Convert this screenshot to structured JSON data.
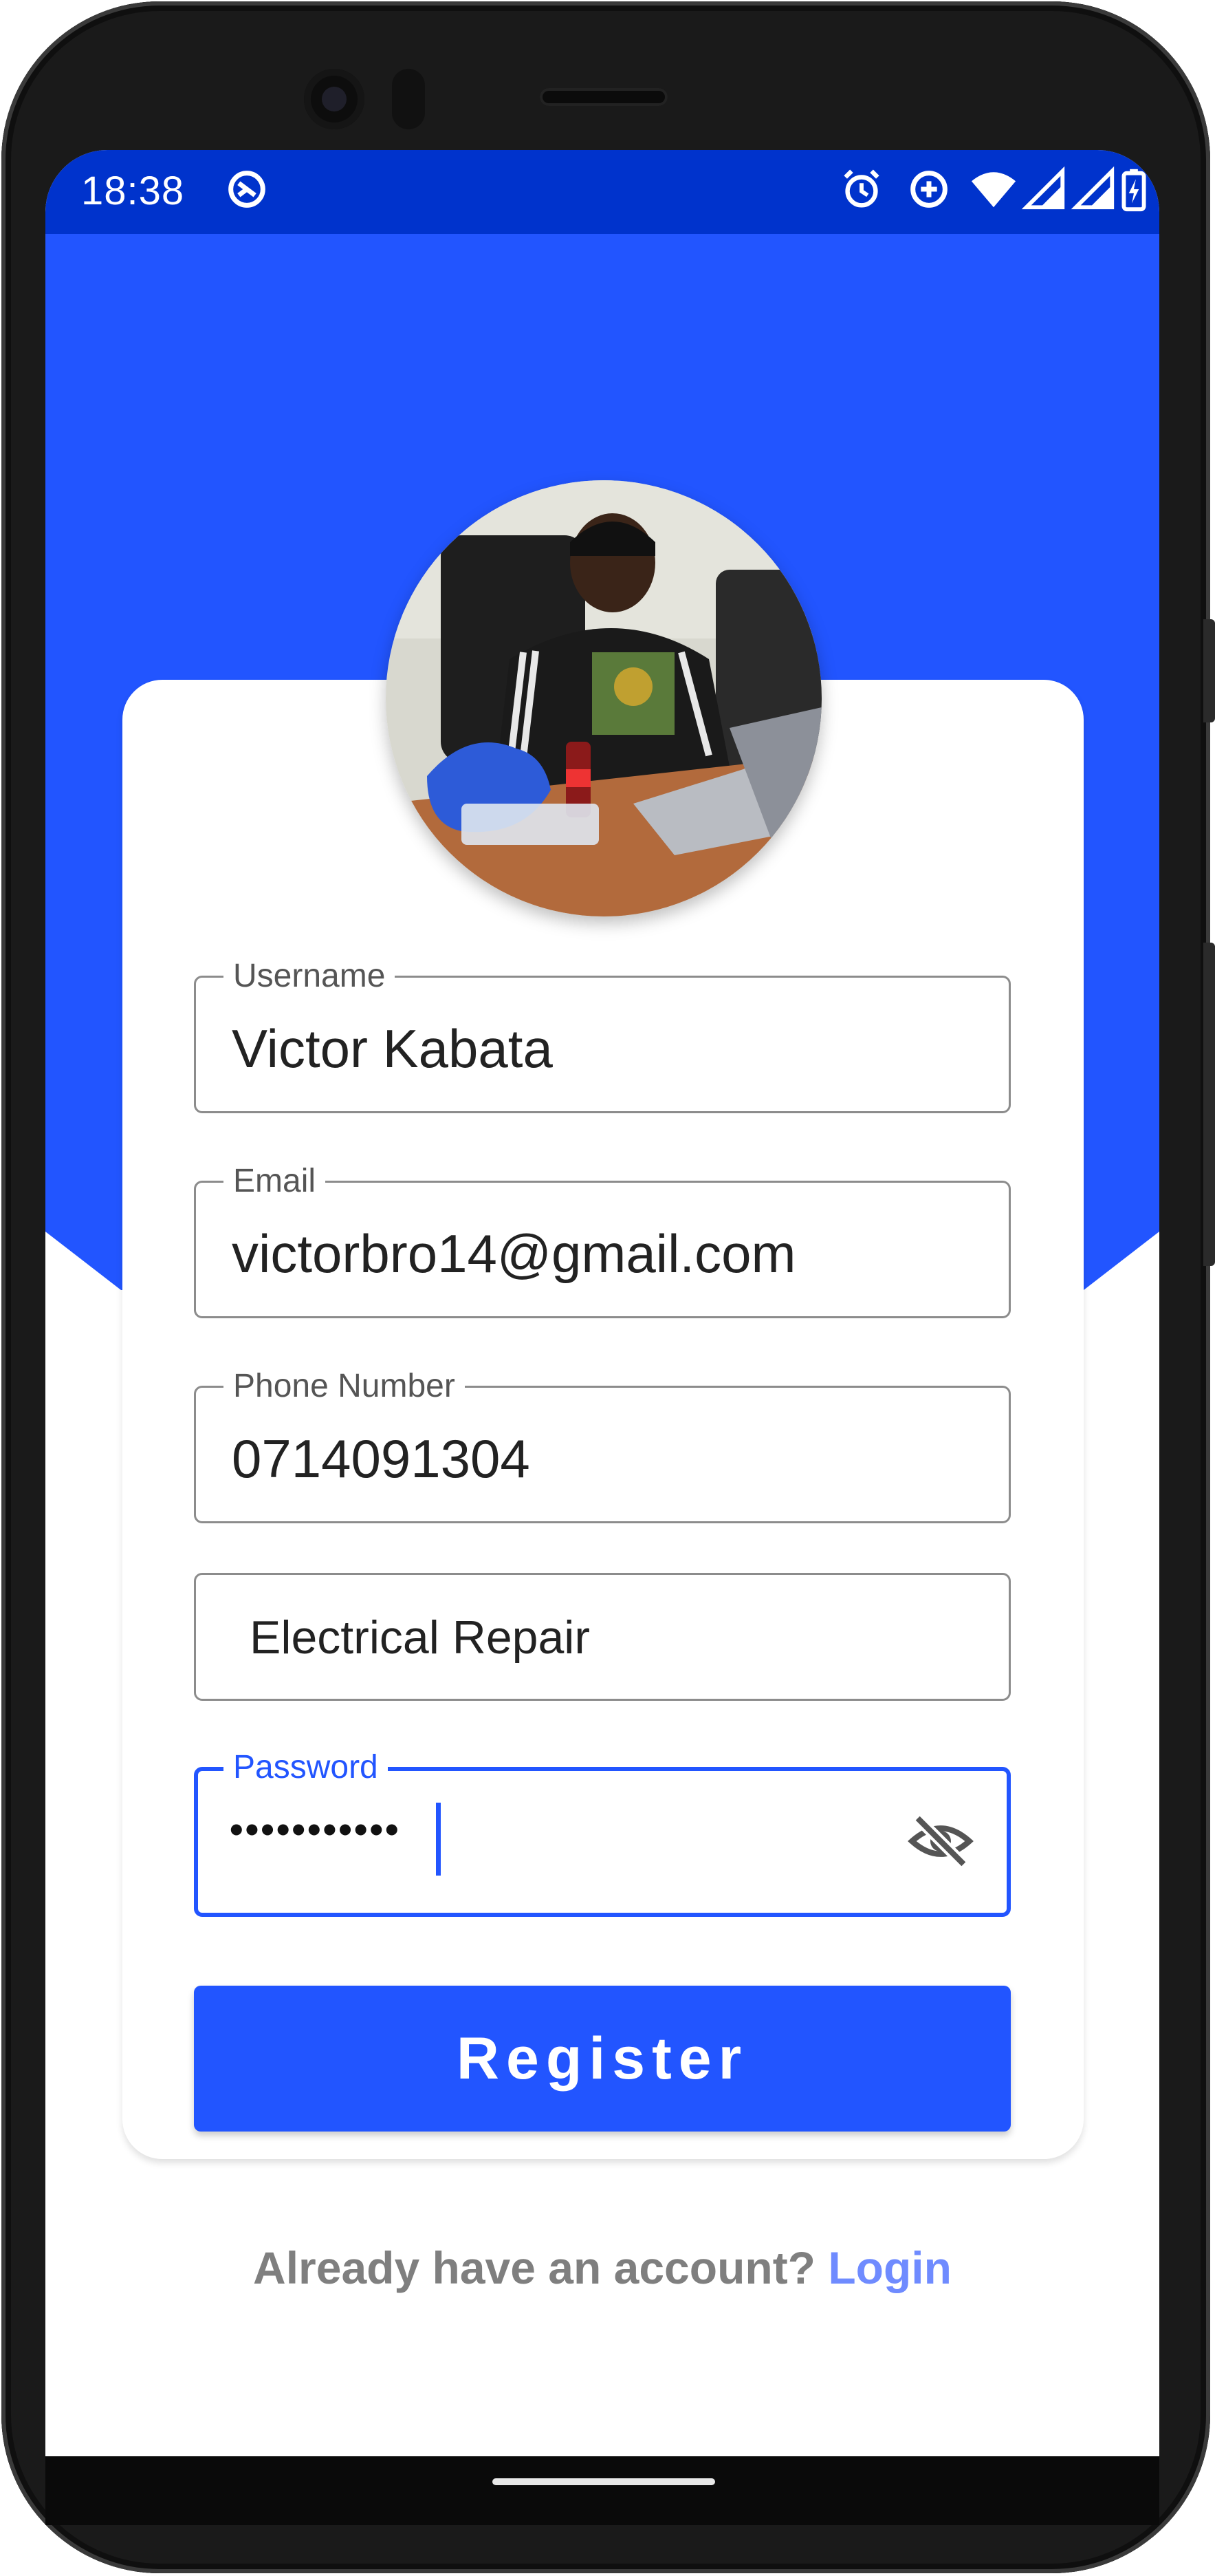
{
  "status_bar": {
    "time": "18:38"
  },
  "form": {
    "username": {
      "label": "Username",
      "value": "Victor Kabata"
    },
    "email": {
      "label": "Email",
      "value": "victorbro14@gmail.com"
    },
    "phone": {
      "label": "Phone Number",
      "value": "0714091304"
    },
    "service": {
      "value": "Electrical Repair"
    },
    "password": {
      "label": "Password",
      "masked_value": "•••••••••••"
    },
    "register_label": "Register"
  },
  "footer": {
    "prompt": "Already have an account?",
    "link": "Login"
  },
  "colors": {
    "primary": "#2255ff",
    "status_bar": "#0033cc",
    "link": "#6f8bff",
    "muted_text": "#7f7f7f"
  },
  "icons": {
    "status_left": "no-sync-icon",
    "status_right": [
      "alarm-icon",
      "data-saver-icon",
      "wifi-icon",
      "signal-icon",
      "signal-icon",
      "battery-charging-icon"
    ],
    "password_toggle": "eye-off-icon"
  }
}
